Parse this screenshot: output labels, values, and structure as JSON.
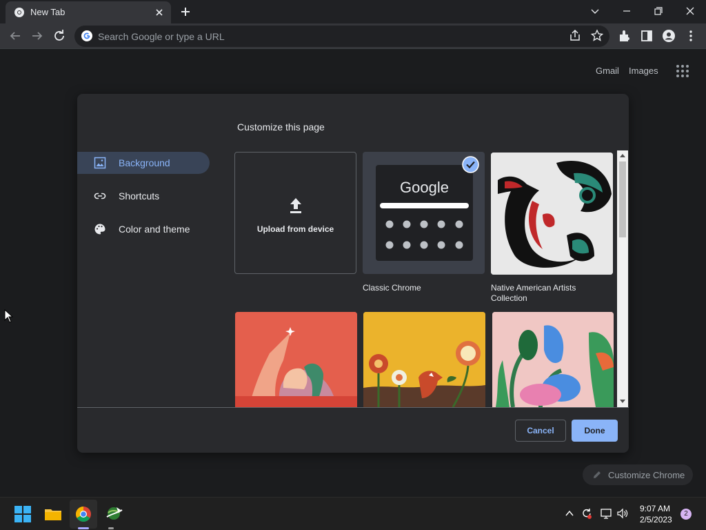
{
  "tab": {
    "title": "New Tab"
  },
  "omnibox": {
    "placeholder": "Search Google or type a URL"
  },
  "header_links": {
    "gmail": "Gmail",
    "images": "Images"
  },
  "dialog": {
    "title": "Customize this page",
    "nav": [
      {
        "label": "Background",
        "icon": "image-icon"
      },
      {
        "label": "Shortcuts",
        "icon": "link-icon"
      },
      {
        "label": "Color and theme",
        "icon": "palette-icon"
      }
    ],
    "tiles": {
      "upload": "Upload from device",
      "classic_label": "Classic Chrome",
      "classic_logo": "Google",
      "native_label_1": "Native American Artists",
      "native_label_2": "Collection"
    },
    "cancel": "Cancel",
    "done": "Done"
  },
  "customize_chrome": "Customize Chrome",
  "taskbar": {
    "time": "9:07 AM",
    "date": "2/5/2023",
    "notifications": "2"
  },
  "colors": {
    "accent": "#8ab4f8",
    "nav_active_bg": "#394457",
    "dialog_bg": "#292a2d"
  }
}
